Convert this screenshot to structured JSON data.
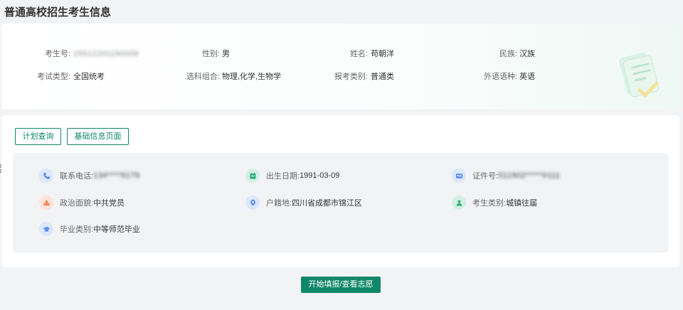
{
  "page": {
    "title": "普通高校招生考生信息"
  },
  "top_info": {
    "exam_no_label": "考生号:",
    "exam_no_value": "25512201150009",
    "gender_label": "性别:",
    "gender_value": "男",
    "name_label": "姓名:",
    "name_value": "苟朝洋",
    "ethnicity_label": "民族:",
    "ethnicity_value": "汉族",
    "exam_type_label": "考试类型:",
    "exam_type_value": "全国统考",
    "subjects_label": "选科组合:",
    "subjects_value": "物理,化学,生物学",
    "category_label": "报考类别:",
    "category_value": "普通类",
    "language_label": "外语语种:",
    "language_value": "英语"
  },
  "actions": {
    "plan_query": "计划查询",
    "basic_info": "基础信息页面",
    "start_fill": "开始填报/查看志愿"
  },
  "details": {
    "phone_label": "联系电话:",
    "phone_value": "134****9179",
    "birth_label": "出生日期:",
    "birth_value": "1991-03-09",
    "id_label": "证件号:",
    "id_value": "511902*****0111",
    "political_label": "政治面貌:",
    "political_value": "中共党员",
    "household_label": "户籍地:",
    "household_value": "四川省成都市锦江区",
    "student_type_label": "考生类别:",
    "student_type_value": "城镇往届",
    "grad_label": "毕业类别:",
    "grad_value": "中等师范毕业"
  },
  "colors": {
    "accent": "#11876a",
    "icon_blue": "#5b8def",
    "icon_green": "#2fae7a",
    "icon_orange": "#f08a5d"
  },
  "icons": [
    "phone-icon",
    "calendar-icon",
    "id-card-icon",
    "party-icon",
    "location-icon",
    "person-icon",
    "graduation-icon",
    "document-illustration"
  ]
}
